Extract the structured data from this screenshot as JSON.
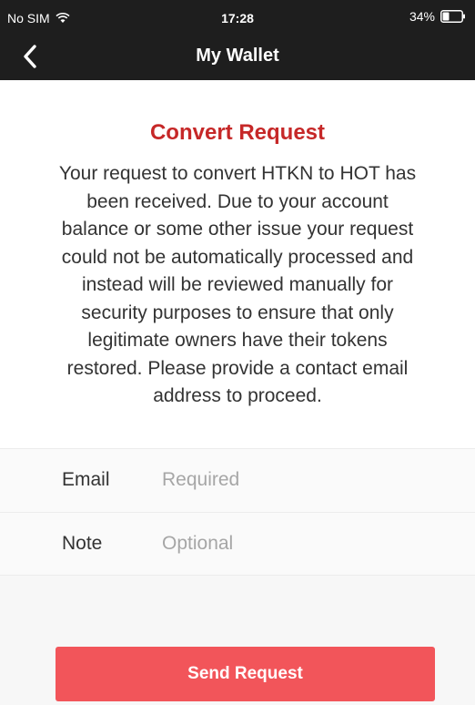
{
  "status_bar": {
    "carrier": "No SIM",
    "time": "17:28",
    "battery": "34%",
    "battery_level": 0.34
  },
  "nav": {
    "title": "My Wallet",
    "back_icon": "chevron-left-icon"
  },
  "card": {
    "title": "Convert Request",
    "message": "Your request to convert HTKN to HOT has been received. Due to your account balance or some other issue your request could not be automatically processed and instead will be reviewed manually for security purposes to ensure that only legitimate owners have their tokens restored. Please provide a contact email address to proceed."
  },
  "form": {
    "email_label": "Email",
    "email_placeholder": "Required",
    "email_value": "",
    "note_label": "Note",
    "note_placeholder": "Optional",
    "note_value": ""
  },
  "actions": {
    "send_label": "Send Request"
  },
  "colors": {
    "title_red": "#c62828",
    "button_red": "#f2555a",
    "header_dark": "#1e1e1e"
  }
}
